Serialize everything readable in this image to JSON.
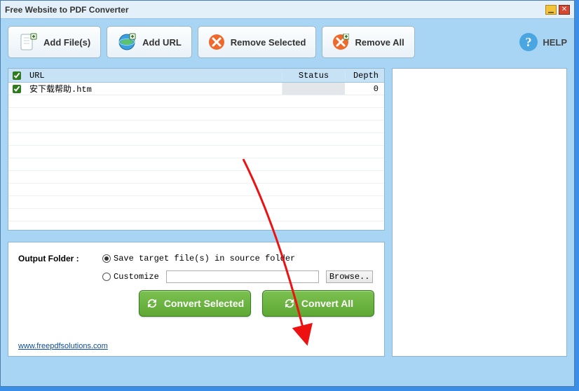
{
  "titlebar": {
    "title": "Free Website to PDF Converter"
  },
  "toolbar": {
    "add_files": "Add File(s)",
    "add_url": "Add URL",
    "remove_selected": "Remove Selected",
    "remove_all": "Remove All",
    "help": "HELP"
  },
  "grid": {
    "headers": {
      "url": "URL",
      "status": "Status",
      "depth": "Depth"
    },
    "rows": [
      {
        "checked": true,
        "url": "安下载帮助.htm",
        "status": "",
        "depth": "0"
      }
    ]
  },
  "output": {
    "label": "Output Folder :",
    "opt_source": "Save target file(s) in source folder",
    "opt_custom": "Customize",
    "browse": "Browse..",
    "path": "",
    "convert_selected": "Convert Selected",
    "convert_all": "Convert All"
  },
  "link": "www.freepdfsolutions.com"
}
